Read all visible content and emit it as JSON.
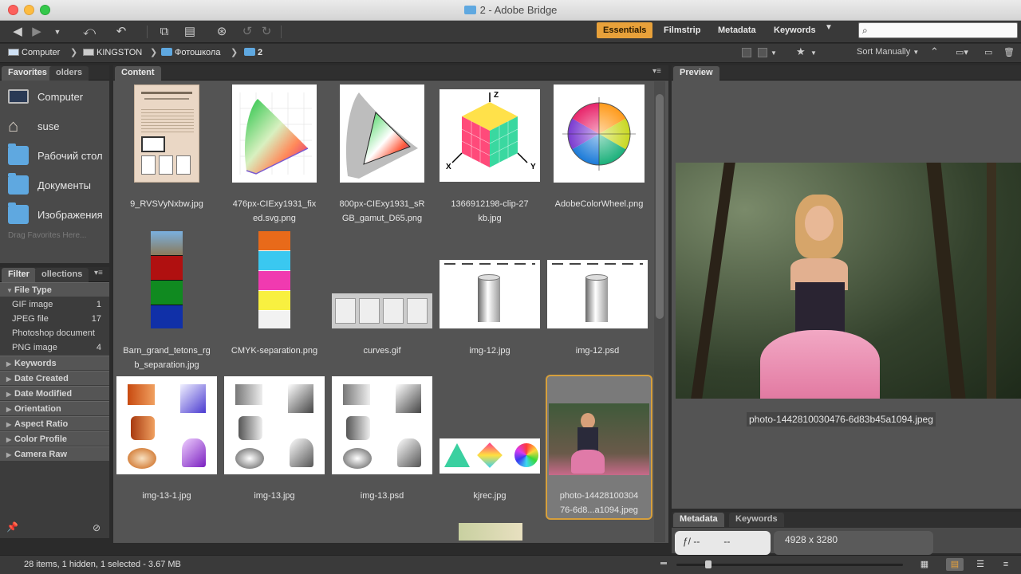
{
  "window": {
    "title": "2 - Adobe Bridge"
  },
  "toolbar": {
    "workspaces": [
      "Essentials",
      "Filmstrip",
      "Metadata",
      "Keywords"
    ],
    "active_workspace": "Essentials",
    "search_placeholder": ""
  },
  "path": {
    "crumbs": [
      "Computer",
      "KINGSTON",
      "Фотошкола",
      "2"
    ],
    "sort_label": "Sort Manually"
  },
  "left": {
    "tabs": [
      "Favorites",
      "olders"
    ],
    "favorites": [
      "Computer",
      "suse",
      "Рабочий стол",
      "Документы",
      "Изображения"
    ],
    "drag_hint": "Drag Favorites Here...",
    "filter_tabs": [
      "Filter",
      "ollections"
    ],
    "file_type_header": "File Type",
    "file_types": [
      {
        "name": "GIF image",
        "count": "1"
      },
      {
        "name": "JPEG file",
        "count": "17"
      },
      {
        "name": "Photoshop document",
        "count": ""
      },
      {
        "name": "PNG image",
        "count": "4"
      }
    ],
    "filter_groups": [
      "Keywords",
      "Date Created",
      "Date Modified",
      "Orientation",
      "Aspect Ratio",
      "Color Profile",
      "Camera Raw"
    ]
  },
  "content": {
    "tab": "Content",
    "items": [
      {
        "line1": "9_RVSVyNxbw.jpg",
        "line2": ""
      },
      {
        "line1": "476px-CIExy1931_fix",
        "line2": "ed.svg.png"
      },
      {
        "line1": "800px-CIExy1931_sR",
        "line2": "GB_gamut_D65.png"
      },
      {
        "line1": "1366912198-clip-27",
        "line2": "kb.jpg"
      },
      {
        "line1": "AdobeColorWheel.png",
        "line2": ""
      },
      {
        "line1": "Barn_grand_tetons_rg",
        "line2": "b_separation.jpg"
      },
      {
        "line1": "CMYK-separation.png",
        "line2": ""
      },
      {
        "line1": "curves.gif",
        "line2": ""
      },
      {
        "line1": "img-12.jpg",
        "line2": ""
      },
      {
        "line1": "img-12.psd",
        "line2": ""
      },
      {
        "line1": "img-13-1.jpg",
        "line2": ""
      },
      {
        "line1": "img-13.jpg",
        "line2": ""
      },
      {
        "line1": "img-13.psd",
        "line2": ""
      },
      {
        "line1": "kjrec.jpg",
        "line2": ""
      },
      {
        "line1": "photo-14428100304",
        "line2": "76-6d8...a1094.jpeg"
      }
    ]
  },
  "preview": {
    "tab": "Preview",
    "filename": "photo-1442810030476-6d83b45a1094.jpeg"
  },
  "metadata": {
    "tabs": [
      "Metadata",
      "Keywords"
    ],
    "aperture_label": "ƒ/ --",
    "aperture_value": "--",
    "dimensions": "4928 x 3280"
  },
  "status": {
    "text": "28 items, 1 hidden, 1 selected - 3.67 MB"
  },
  "colors": {
    "accent": "#e8a13a",
    "selection_border": "#d69f3c",
    "folder": "#5fa8e0"
  }
}
